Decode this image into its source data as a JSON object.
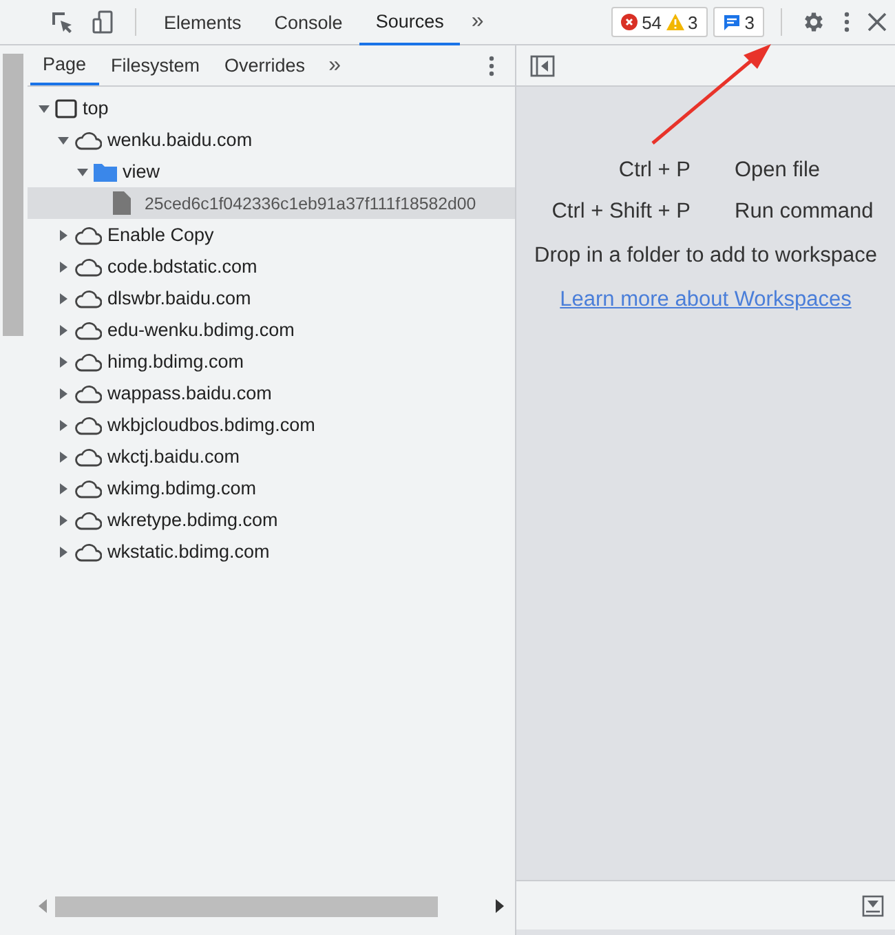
{
  "toolbar": {
    "tabs": [
      {
        "label": "Elements",
        "selected": false
      },
      {
        "label": "Console",
        "selected": false
      },
      {
        "label": "Sources",
        "selected": true
      }
    ],
    "more": "»",
    "errors": "54",
    "warnings": "3",
    "messages": "3"
  },
  "navigator": {
    "tabs": [
      {
        "label": "Page",
        "selected": true
      },
      {
        "label": "Filesystem",
        "selected": false
      },
      {
        "label": "Overrides",
        "selected": false
      }
    ],
    "more": "»",
    "tree": [
      {
        "kind": "frame",
        "label": "top",
        "expanded": true,
        "selected": false,
        "children": [
          {
            "kind": "domain",
            "label": "wenku.baidu.com",
            "expanded": true,
            "selected": false,
            "children": [
              {
                "kind": "folder",
                "label": "view",
                "expanded": true,
                "selected": false,
                "children": [
                  {
                    "kind": "file",
                    "label": "25ced6c1f042336c1eb91a37f111f18582d00",
                    "selected": true
                  }
                ]
              }
            ]
          },
          {
            "kind": "domain",
            "label": "Enable Copy",
            "expanded": false,
            "selected": false
          },
          {
            "kind": "domain",
            "label": "code.bdstatic.com",
            "expanded": false,
            "selected": false
          },
          {
            "kind": "domain",
            "label": "dlswbr.baidu.com",
            "expanded": false,
            "selected": false
          },
          {
            "kind": "domain",
            "label": "edu-wenku.bdimg.com",
            "expanded": false,
            "selected": false
          },
          {
            "kind": "domain",
            "label": "himg.bdimg.com",
            "expanded": false,
            "selected": false
          },
          {
            "kind": "domain",
            "label": "wappass.baidu.com",
            "expanded": false,
            "selected": false
          },
          {
            "kind": "domain",
            "label": "wkbjcloudbos.bdimg.com",
            "expanded": false,
            "selected": false
          },
          {
            "kind": "domain",
            "label": "wkctj.baidu.com",
            "expanded": false,
            "selected": false
          },
          {
            "kind": "domain",
            "label": "wkimg.bdimg.com",
            "expanded": false,
            "selected": false
          },
          {
            "kind": "domain",
            "label": "wkretype.bdimg.com",
            "expanded": false,
            "selected": false
          },
          {
            "kind": "domain",
            "label": "wkstatic.bdimg.com",
            "expanded": false,
            "selected": false
          }
        ]
      }
    ]
  },
  "editor": {
    "shortcuts": [
      {
        "keys": "Ctrl + P",
        "action": "Open file"
      },
      {
        "keys": "Ctrl + Shift + P",
        "action": "Run command"
      }
    ],
    "drop_hint": "Drop in a folder to add to workspace",
    "link": "Learn more about Workspaces"
  }
}
